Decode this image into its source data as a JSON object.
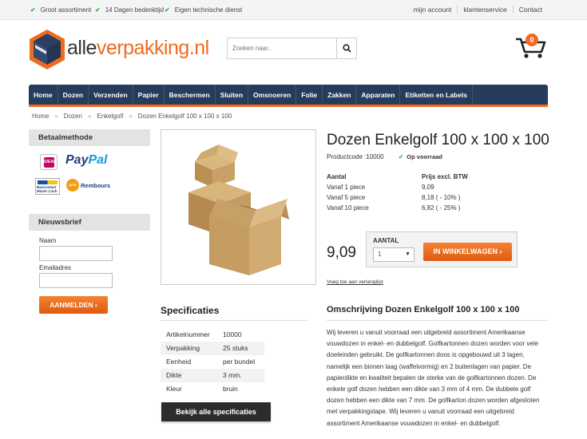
{
  "topbar": {
    "usps": [
      "Groot assortiment",
      "14 Dagen bedenktijd",
      "Eigen technische dienst"
    ],
    "links": [
      "mijn account",
      "klantenservice",
      "Contact"
    ]
  },
  "logo": {
    "part1": "alle",
    "part2": "verpakking.nl"
  },
  "search": {
    "placeholder": "Zoeken naar.."
  },
  "cart": {
    "count": "0"
  },
  "nav": [
    "Home",
    "Dozen",
    "Verzenden",
    "Papier",
    "Beschermen",
    "Sluiten",
    "Omsnoeren",
    "Folie",
    "Zakken",
    "Apparaten",
    "Etiketten en Labels"
  ],
  "breadcrumb": [
    "Home",
    "Dozen",
    "Enkelgolf",
    "Dozen Enkelgolf 100 x 100 x 100"
  ],
  "sidebar": {
    "payment_title": "Betaalmethode",
    "payment": {
      "ideal": "iDEAL",
      "paypal_a": "Pay",
      "paypal_b": "Pal",
      "bancontact_a": "Bancontact",
      "bancontact_b": "Mister Cash",
      "post": "post",
      "rembours": "Rembours"
    },
    "newsletter_title": "Nieuwsbrief",
    "name_label": "Naam",
    "email_label": "Emailadres",
    "subscribe": "AANMELDEN ›"
  },
  "product": {
    "title": "Dozen Enkelgolf 100 x 100 x 100",
    "code": "Productcode :10000",
    "stock": "Op voorraad",
    "price_header": [
      "Aantal",
      "Prijs excl. BTW"
    ],
    "price_rows": [
      [
        "Vanaf 1 piece",
        "9,09"
      ],
      [
        "Vanaf 5 piece",
        "8,18 ( - 10% )"
      ],
      [
        "Vanaf 10 piece",
        "6,82 ( - 25% )"
      ]
    ],
    "price": "9,09",
    "qty_label": "AANTAL",
    "qty_value": "1",
    "add_to_cart": "IN WINKELWAGEN ›",
    "wishlist": "Voeg toe aan verlanglijst"
  },
  "specs": {
    "title": "Specificaties",
    "rows": [
      [
        "Artikelnummer",
        "10000"
      ],
      [
        "Verpakking",
        "25 stuks"
      ],
      [
        "Eenheid",
        "per bundel"
      ],
      [
        "Dikte",
        "3 mm."
      ],
      [
        "Kleur",
        "bruin"
      ]
    ],
    "button": "Bekijk alle specificaties"
  },
  "description": {
    "title": "Omschrijving Dozen Enkelgolf 100 x 100 x 100",
    "text": "Wij leveren u vanuit voorraad een uitgebreid assortiment Amerikaanse vouwdozen in enkel- en dubbelgolf. Golfkartonnen dozen worden voor vele doeleinden gebruikt. De golfkartonnen doos is opgebouwd uit 3 lagen, namelijk een binnen laag (waffelvormig) en 2 buitenlagen van papier. De papierdikte en kwaliteit bepalen de sterke van de golfkartonnen dozen. De enkele golf dozen hebben een dikte van 3 mm of 4 mm. De dubbele golf dozen hebben een dikte van 7 mm. De golfkarton dozen worden afgesloten met verpakkingstape. Wij leveren u vanuit voorraad een uitgebreid assortiment Amerikaanse vouwdozen in enkel- en dubbelgolf."
  },
  "colors": {
    "navy": "#273b5c",
    "orange": "#f06b1f",
    "green": "#3bb54a"
  }
}
